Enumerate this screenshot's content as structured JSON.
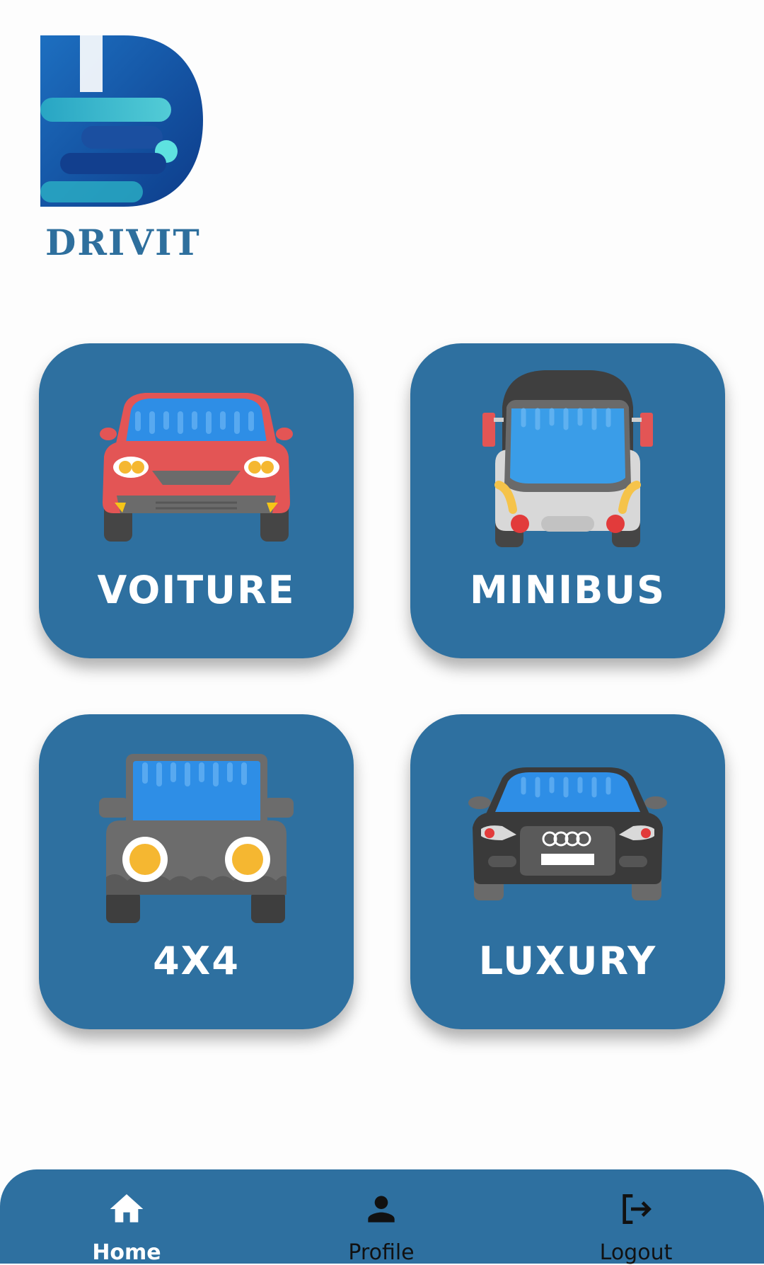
{
  "brand": {
    "logo_text": "DRIVIT",
    "colors": {
      "primary": "#2e70a0",
      "logo_dark": "#0f3f8c",
      "logo_light": "#4fd7dd"
    }
  },
  "categories": [
    {
      "label": "VOITURE",
      "icon": "red-car-icon"
    },
    {
      "label": "MINIBUS",
      "icon": "minibus-icon"
    },
    {
      "label": "4X4",
      "icon": "jeep-4x4-icon"
    },
    {
      "label": "LUXURY",
      "icon": "luxury-car-icon"
    }
  ],
  "bottom_nav": {
    "items": [
      {
        "label": "Home",
        "icon": "home-icon",
        "active": true
      },
      {
        "label": "Profile",
        "icon": "person-icon",
        "active": false
      },
      {
        "label": "Logout",
        "icon": "logout-icon",
        "active": false
      }
    ]
  }
}
